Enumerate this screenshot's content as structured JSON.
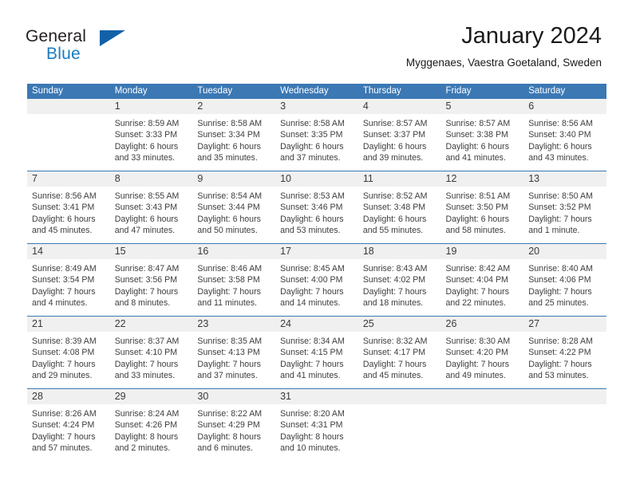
{
  "brand": {
    "word1": "General",
    "word2": "Blue",
    "logo_icon": "triangle-logo-icon",
    "accent_color": "#1261a8",
    "blue_text_color": "#1a7bc4"
  },
  "header": {
    "month_title": "January 2024",
    "location": "Myggenaes, Vaestra Goetaland, Sweden"
  },
  "calendar": {
    "header_bg_color": "#3b78b4",
    "daynum_bg_color": "#f0f0f0",
    "weekday_headers": [
      "Sunday",
      "Monday",
      "Tuesday",
      "Wednesday",
      "Thursday",
      "Friday",
      "Saturday"
    ],
    "weeks": [
      [
        {
          "day": "",
          "sunrise": "",
          "sunset": "",
          "daylight_line1": "",
          "daylight_line2": ""
        },
        {
          "day": "1",
          "sunrise": "Sunrise: 8:59 AM",
          "sunset": "Sunset: 3:33 PM",
          "daylight_line1": "Daylight: 6 hours",
          "daylight_line2": "and 33 minutes."
        },
        {
          "day": "2",
          "sunrise": "Sunrise: 8:58 AM",
          "sunset": "Sunset: 3:34 PM",
          "daylight_line1": "Daylight: 6 hours",
          "daylight_line2": "and 35 minutes."
        },
        {
          "day": "3",
          "sunrise": "Sunrise: 8:58 AM",
          "sunset": "Sunset: 3:35 PM",
          "daylight_line1": "Daylight: 6 hours",
          "daylight_line2": "and 37 minutes."
        },
        {
          "day": "4",
          "sunrise": "Sunrise: 8:57 AM",
          "sunset": "Sunset: 3:37 PM",
          "daylight_line1": "Daylight: 6 hours",
          "daylight_line2": "and 39 minutes."
        },
        {
          "day": "5",
          "sunrise": "Sunrise: 8:57 AM",
          "sunset": "Sunset: 3:38 PM",
          "daylight_line1": "Daylight: 6 hours",
          "daylight_line2": "and 41 minutes."
        },
        {
          "day": "6",
          "sunrise": "Sunrise: 8:56 AM",
          "sunset": "Sunset: 3:40 PM",
          "daylight_line1": "Daylight: 6 hours",
          "daylight_line2": "and 43 minutes."
        }
      ],
      [
        {
          "day": "7",
          "sunrise": "Sunrise: 8:56 AM",
          "sunset": "Sunset: 3:41 PM",
          "daylight_line1": "Daylight: 6 hours",
          "daylight_line2": "and 45 minutes."
        },
        {
          "day": "8",
          "sunrise": "Sunrise: 8:55 AM",
          "sunset": "Sunset: 3:43 PM",
          "daylight_line1": "Daylight: 6 hours",
          "daylight_line2": "and 47 minutes."
        },
        {
          "day": "9",
          "sunrise": "Sunrise: 8:54 AM",
          "sunset": "Sunset: 3:44 PM",
          "daylight_line1": "Daylight: 6 hours",
          "daylight_line2": "and 50 minutes."
        },
        {
          "day": "10",
          "sunrise": "Sunrise: 8:53 AM",
          "sunset": "Sunset: 3:46 PM",
          "daylight_line1": "Daylight: 6 hours",
          "daylight_line2": "and 53 minutes."
        },
        {
          "day": "11",
          "sunrise": "Sunrise: 8:52 AM",
          "sunset": "Sunset: 3:48 PM",
          "daylight_line1": "Daylight: 6 hours",
          "daylight_line2": "and 55 minutes."
        },
        {
          "day": "12",
          "sunrise": "Sunrise: 8:51 AM",
          "sunset": "Sunset: 3:50 PM",
          "daylight_line1": "Daylight: 6 hours",
          "daylight_line2": "and 58 minutes."
        },
        {
          "day": "13",
          "sunrise": "Sunrise: 8:50 AM",
          "sunset": "Sunset: 3:52 PM",
          "daylight_line1": "Daylight: 7 hours",
          "daylight_line2": "and 1 minute."
        }
      ],
      [
        {
          "day": "14",
          "sunrise": "Sunrise: 8:49 AM",
          "sunset": "Sunset: 3:54 PM",
          "daylight_line1": "Daylight: 7 hours",
          "daylight_line2": "and 4 minutes."
        },
        {
          "day": "15",
          "sunrise": "Sunrise: 8:47 AM",
          "sunset": "Sunset: 3:56 PM",
          "daylight_line1": "Daylight: 7 hours",
          "daylight_line2": "and 8 minutes."
        },
        {
          "day": "16",
          "sunrise": "Sunrise: 8:46 AM",
          "sunset": "Sunset: 3:58 PM",
          "daylight_line1": "Daylight: 7 hours",
          "daylight_line2": "and 11 minutes."
        },
        {
          "day": "17",
          "sunrise": "Sunrise: 8:45 AM",
          "sunset": "Sunset: 4:00 PM",
          "daylight_line1": "Daylight: 7 hours",
          "daylight_line2": "and 14 minutes."
        },
        {
          "day": "18",
          "sunrise": "Sunrise: 8:43 AM",
          "sunset": "Sunset: 4:02 PM",
          "daylight_line1": "Daylight: 7 hours",
          "daylight_line2": "and 18 minutes."
        },
        {
          "day": "19",
          "sunrise": "Sunrise: 8:42 AM",
          "sunset": "Sunset: 4:04 PM",
          "daylight_line1": "Daylight: 7 hours",
          "daylight_line2": "and 22 minutes."
        },
        {
          "day": "20",
          "sunrise": "Sunrise: 8:40 AM",
          "sunset": "Sunset: 4:06 PM",
          "daylight_line1": "Daylight: 7 hours",
          "daylight_line2": "and 25 minutes."
        }
      ],
      [
        {
          "day": "21",
          "sunrise": "Sunrise: 8:39 AM",
          "sunset": "Sunset: 4:08 PM",
          "daylight_line1": "Daylight: 7 hours",
          "daylight_line2": "and 29 minutes."
        },
        {
          "day": "22",
          "sunrise": "Sunrise: 8:37 AM",
          "sunset": "Sunset: 4:10 PM",
          "daylight_line1": "Daylight: 7 hours",
          "daylight_line2": "and 33 minutes."
        },
        {
          "day": "23",
          "sunrise": "Sunrise: 8:35 AM",
          "sunset": "Sunset: 4:13 PM",
          "daylight_line1": "Daylight: 7 hours",
          "daylight_line2": "and 37 minutes."
        },
        {
          "day": "24",
          "sunrise": "Sunrise: 8:34 AM",
          "sunset": "Sunset: 4:15 PM",
          "daylight_line1": "Daylight: 7 hours",
          "daylight_line2": "and 41 minutes."
        },
        {
          "day": "25",
          "sunrise": "Sunrise: 8:32 AM",
          "sunset": "Sunset: 4:17 PM",
          "daylight_line1": "Daylight: 7 hours",
          "daylight_line2": "and 45 minutes."
        },
        {
          "day": "26",
          "sunrise": "Sunrise: 8:30 AM",
          "sunset": "Sunset: 4:20 PM",
          "daylight_line1": "Daylight: 7 hours",
          "daylight_line2": "and 49 minutes."
        },
        {
          "day": "27",
          "sunrise": "Sunrise: 8:28 AM",
          "sunset": "Sunset: 4:22 PM",
          "daylight_line1": "Daylight: 7 hours",
          "daylight_line2": "and 53 minutes."
        }
      ],
      [
        {
          "day": "28",
          "sunrise": "Sunrise: 8:26 AM",
          "sunset": "Sunset: 4:24 PM",
          "daylight_line1": "Daylight: 7 hours",
          "daylight_line2": "and 57 minutes."
        },
        {
          "day": "29",
          "sunrise": "Sunrise: 8:24 AM",
          "sunset": "Sunset: 4:26 PM",
          "daylight_line1": "Daylight: 8 hours",
          "daylight_line2": "and 2 minutes."
        },
        {
          "day": "30",
          "sunrise": "Sunrise: 8:22 AM",
          "sunset": "Sunset: 4:29 PM",
          "daylight_line1": "Daylight: 8 hours",
          "daylight_line2": "and 6 minutes."
        },
        {
          "day": "31",
          "sunrise": "Sunrise: 8:20 AM",
          "sunset": "Sunset: 4:31 PM",
          "daylight_line1": "Daylight: 8 hours",
          "daylight_line2": "and 10 minutes."
        },
        {
          "day": "",
          "sunrise": "",
          "sunset": "",
          "daylight_line1": "",
          "daylight_line2": ""
        },
        {
          "day": "",
          "sunrise": "",
          "sunset": "",
          "daylight_line1": "",
          "daylight_line2": ""
        },
        {
          "day": "",
          "sunrise": "",
          "sunset": "",
          "daylight_line1": "",
          "daylight_line2": ""
        }
      ]
    ]
  }
}
